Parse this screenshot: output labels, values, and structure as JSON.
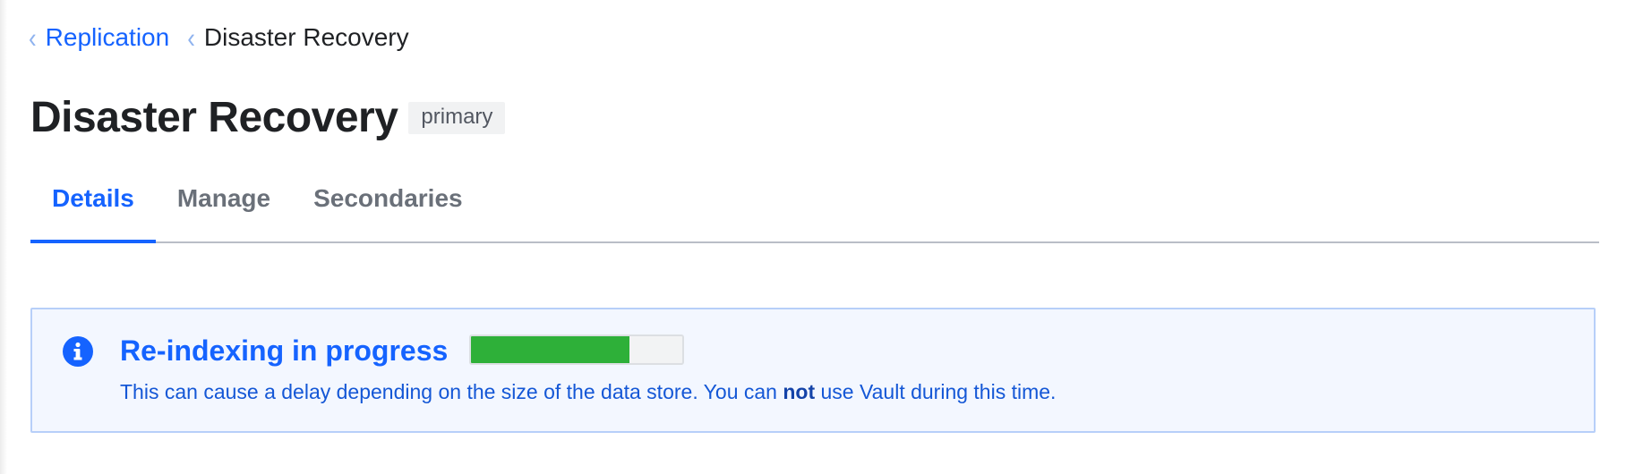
{
  "breadcrumb": {
    "items": [
      {
        "label": "Replication",
        "link": true
      },
      {
        "label": "Disaster Recovery",
        "link": false
      }
    ]
  },
  "page": {
    "title": "Disaster Recovery",
    "badge": "primary"
  },
  "tabs": [
    {
      "label": "Details",
      "active": true
    },
    {
      "label": "Manage",
      "active": false
    },
    {
      "label": "Secondaries",
      "active": false
    }
  ],
  "alert": {
    "icon": "info-circle-icon",
    "title": "Re-indexing in progress",
    "progress_fraction": 0.75,
    "body_before": "This can cause a delay depending on the size of the data store. You can ",
    "body_emphasis": "not",
    "body_after": " use Vault during this time."
  },
  "colors": {
    "accent": "#1563ff",
    "progress_fill": "#2eb039",
    "alert_background": "#f3f7ff",
    "alert_border": "#b7cff9"
  }
}
